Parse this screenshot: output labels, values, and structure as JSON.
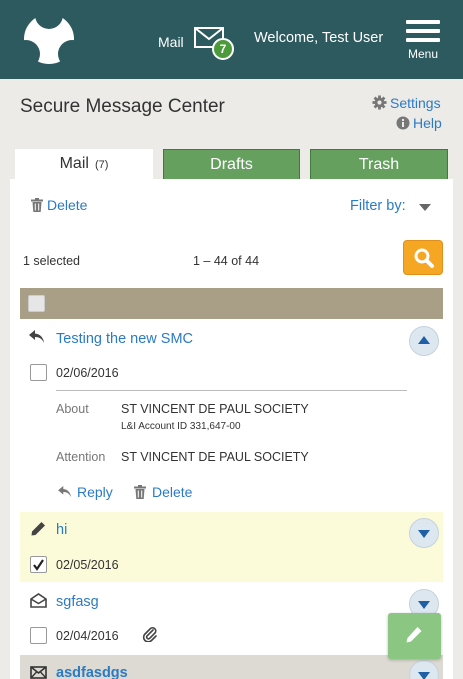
{
  "header": {
    "mail_label": "Mail",
    "unread_count": "7",
    "welcome": "Welcome, Test User",
    "menu_label": "Menu"
  },
  "page": {
    "title": "Secure Message Center",
    "settings_label": "Settings",
    "help_label": "Help"
  },
  "tabs": {
    "mail": {
      "label": "Mail",
      "count": "(7)"
    },
    "drafts": {
      "label": "Drafts"
    },
    "trash": {
      "label": "Trash"
    }
  },
  "toolbar": {
    "delete_label": "Delete",
    "filter_label": "Filter by:",
    "selected_text": "1 selected",
    "range_text": "1 – 44 of 44"
  },
  "messages": [
    {
      "subject": "Testing the new SMC",
      "date": "02/06/2016",
      "status_icon": "reply-icon",
      "checked": false,
      "expanded": true,
      "about_label": "About",
      "about_value": "ST VINCENT DE PAUL SOCIETY",
      "account_line": "L&I Account ID 331,647-00",
      "attention_label": "Attention",
      "attention_value": "ST VINCENT DE PAUL SOCIETY",
      "reply_label": "Reply",
      "delete_label": "Delete"
    },
    {
      "subject": "hi",
      "date": "02/05/2016",
      "status_icon": "pencil-icon",
      "checked": true,
      "expanded": false
    },
    {
      "subject": "sgfasg",
      "date": "02/04/2016",
      "status_icon": "envelope-open-icon",
      "attachment": true,
      "checked": false,
      "expanded": false
    },
    {
      "subject": "asdfasdgs",
      "status_icon": "envelope-icon",
      "unread": true
    }
  ],
  "colors": {
    "header_bg": "#2d5a5f",
    "link": "#2b7bc4",
    "tab_green": "#65a05f",
    "search_orange": "#f5a623",
    "select_bar": "#a89f86",
    "draft_highlight": "#fbfbd9",
    "fab_green": "#8bc683"
  }
}
